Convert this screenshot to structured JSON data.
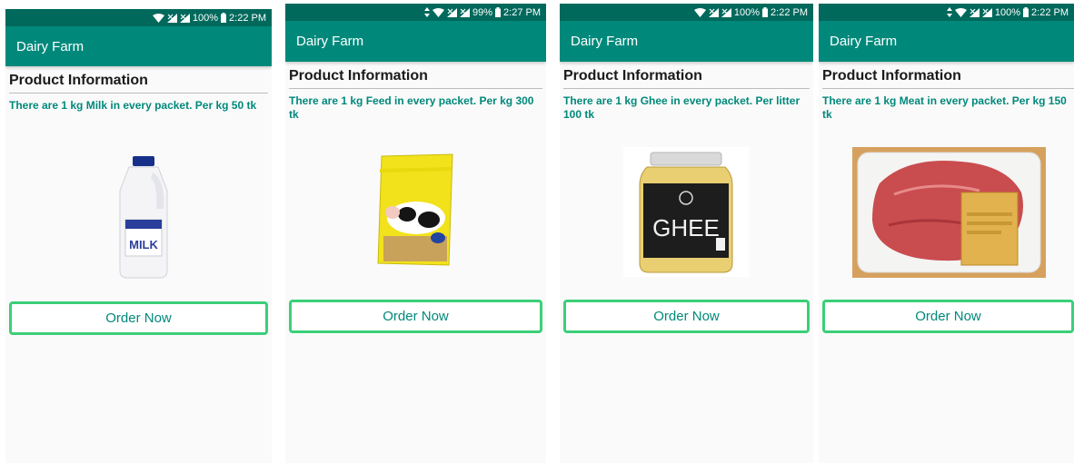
{
  "screens": [
    {
      "status": {
        "battery": "100%",
        "time": "2:22 PM",
        "icons": [
          "wifi-icon",
          "signal-icon",
          "signal-icon",
          "battery-icon"
        ]
      },
      "app_title": "Dairy Farm",
      "section_title": "Product Information",
      "description": "There are 1 kg Milk in every packet. Per kg 50 tk",
      "product_icon": "milk-jug-icon",
      "product_label": "MILK",
      "order_label": "Order Now"
    },
    {
      "status": {
        "battery": "99%",
        "time": "2:27 PM",
        "icons": [
          "data-arrows-icon",
          "wifi-icon",
          "signal-icon",
          "signal-icon",
          "battery-icon"
        ]
      },
      "app_title": "Dairy Farm",
      "section_title": "Product Information",
      "description": "There are 1 kg Feed in every packet. Per kg 300 tk",
      "product_icon": "feed-bag-icon",
      "order_label": "Order Now"
    },
    {
      "status": {
        "battery": "100%",
        "time": "2:22 PM",
        "icons": [
          "wifi-icon",
          "signal-icon",
          "signal-icon",
          "battery-icon"
        ]
      },
      "app_title": "Dairy Farm",
      "section_title": "Product Information",
      "description": "There are 1 kg Ghee in every packet. Per litter 100 tk",
      "product_icon": "ghee-jar-icon",
      "product_label": "GHEE",
      "order_label": "Order Now"
    },
    {
      "status": {
        "battery": "100%",
        "time": "2:22 PM",
        "icons": [
          "data-arrows-icon",
          "wifi-icon",
          "signal-icon",
          "signal-icon",
          "battery-icon"
        ]
      },
      "app_title": "Dairy Farm",
      "section_title": "Product Information",
      "description": "There are 1 kg Meat in every packet. Per kg 150 tk",
      "product_icon": "meat-tray-icon",
      "order_label": "Order Now"
    }
  ],
  "colors": {
    "status_bar": "#00695c",
    "app_bar": "#00897b",
    "accent_text": "#00897b",
    "button_border": "#3ccf78"
  }
}
